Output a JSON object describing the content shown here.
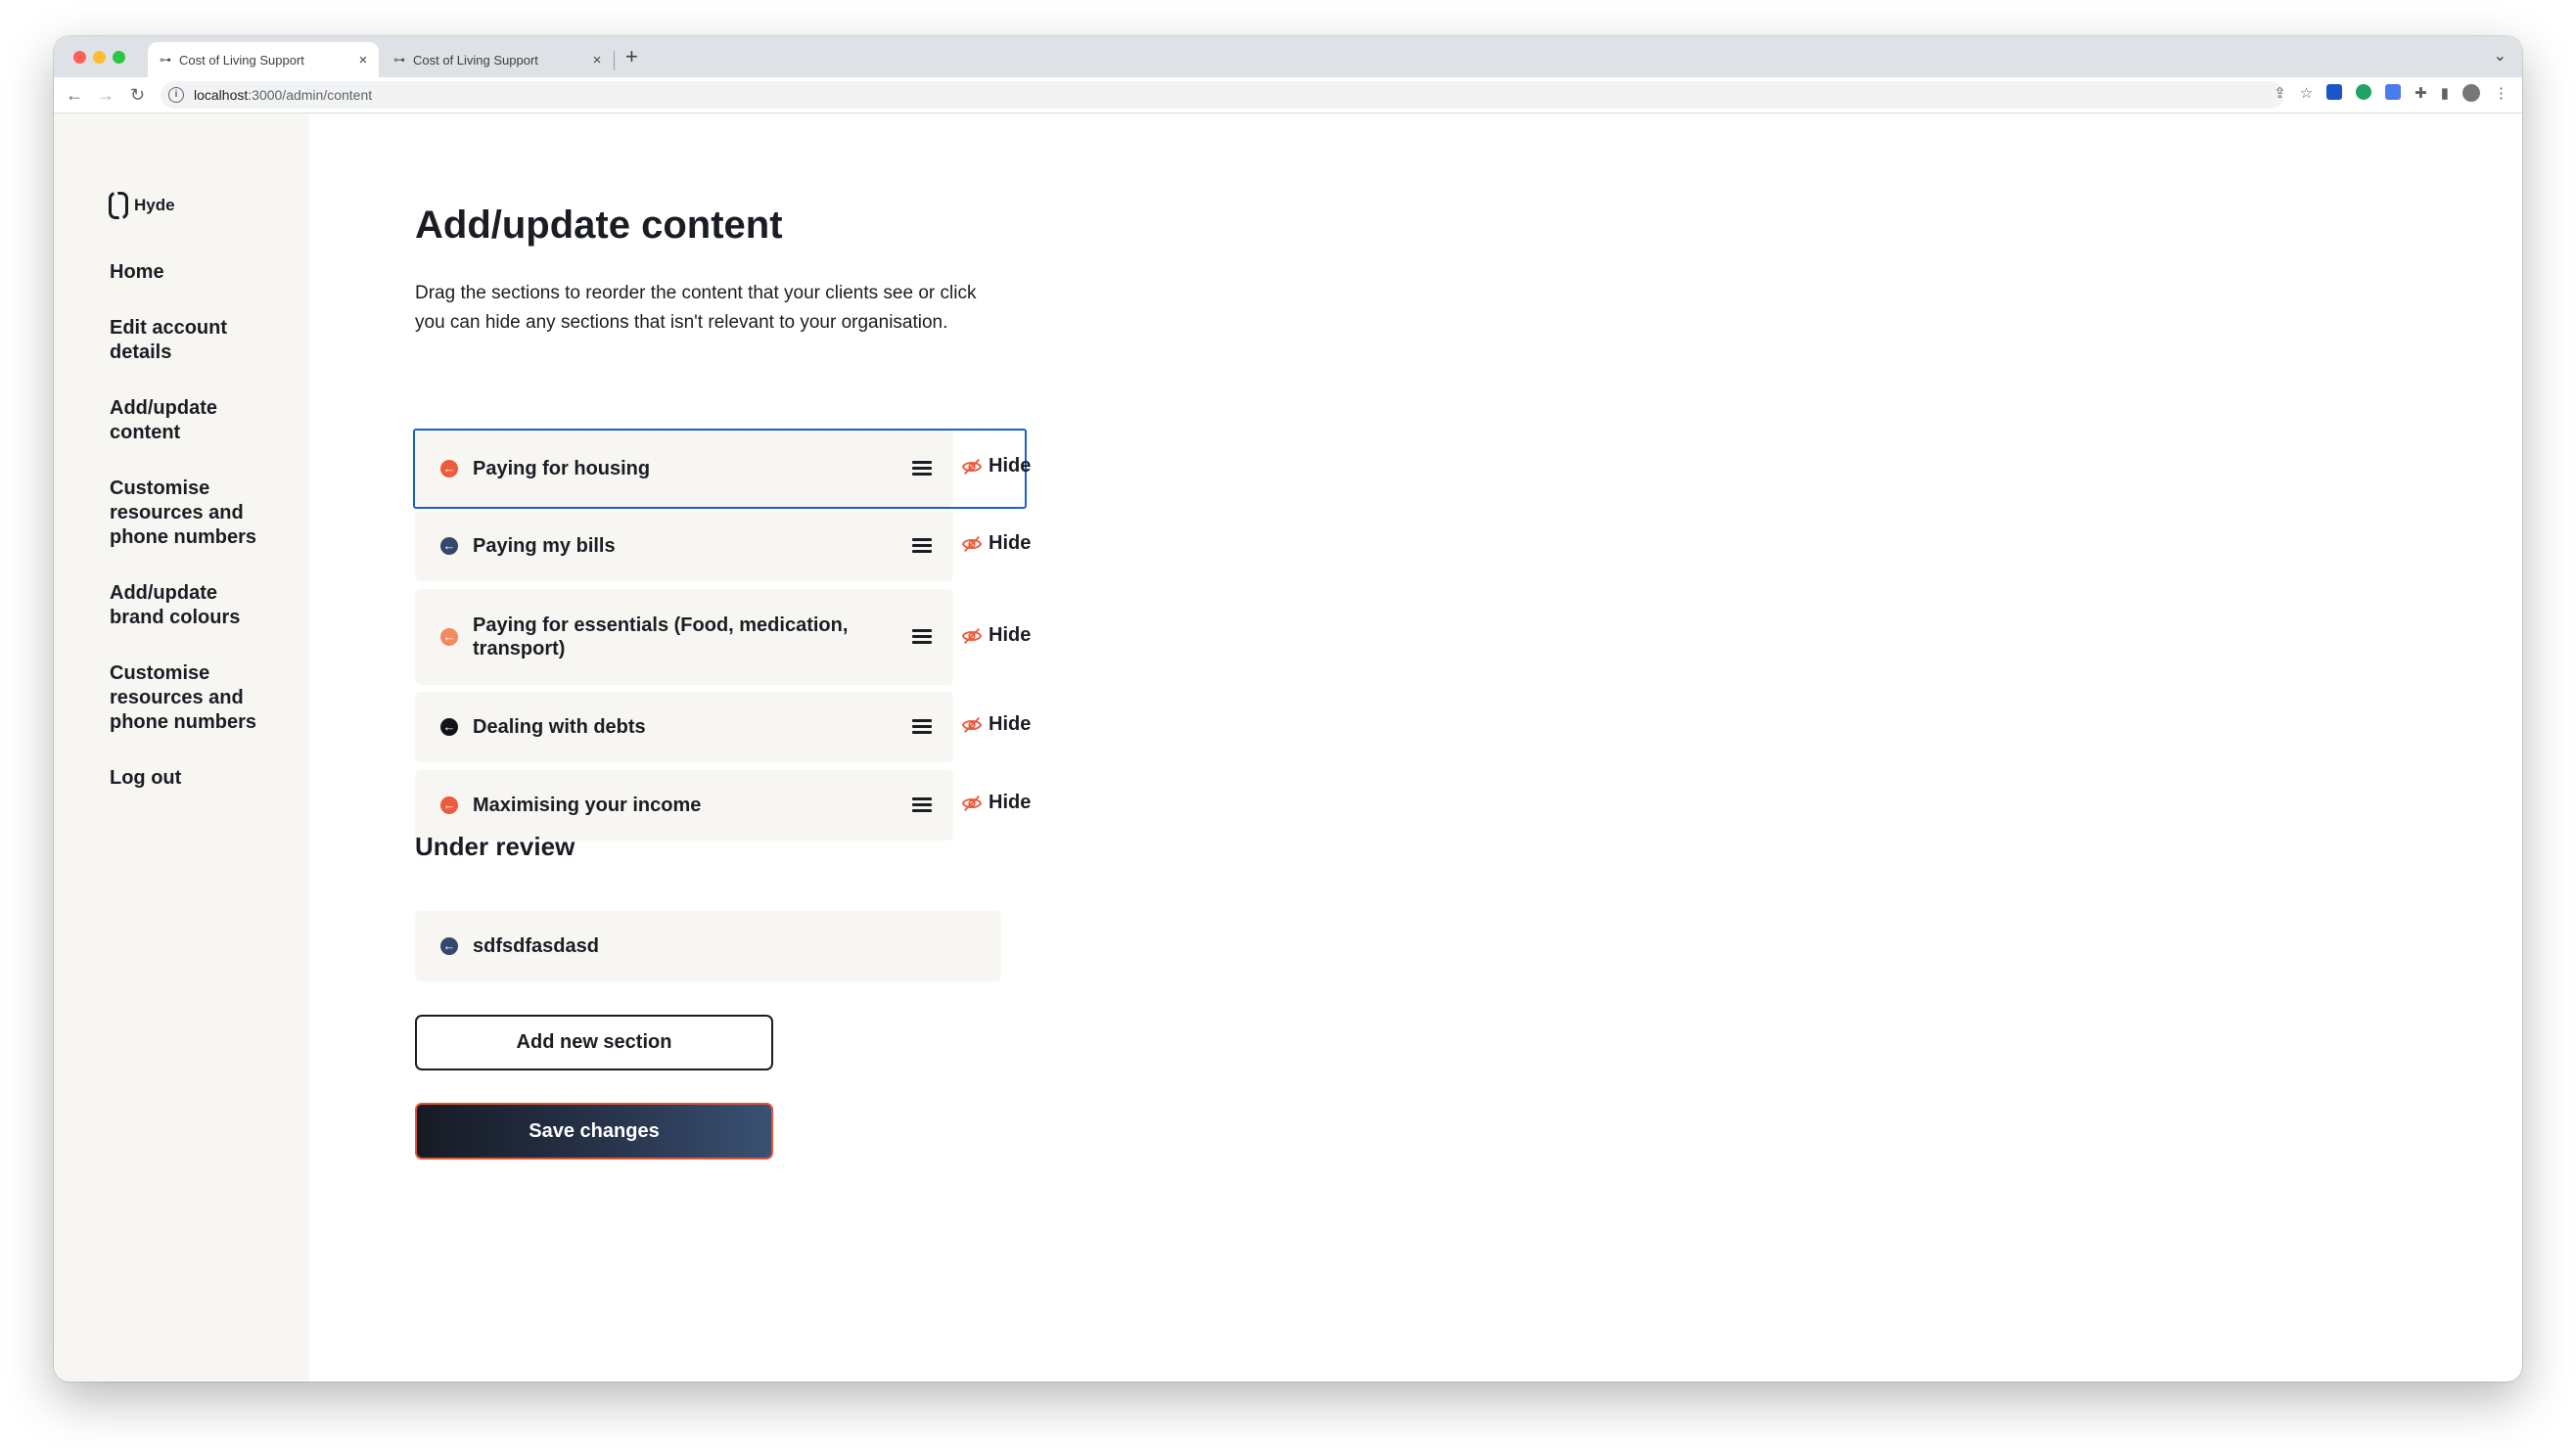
{
  "browser": {
    "tabs": [
      {
        "title": "Cost of Living Support",
        "active": true
      },
      {
        "title": "Cost of Living Support",
        "active": false
      }
    ],
    "url_host": "localhost",
    "url_path": ":3000/admin/content"
  },
  "sidebar": {
    "logo_text": "Hyde",
    "items": [
      {
        "label": "Home"
      },
      {
        "label": "Edit account details"
      },
      {
        "label": "Add/update content"
      },
      {
        "label": "Customise resources and phone numbers"
      },
      {
        "label": "Add/update brand colours"
      },
      {
        "label": "Customise resources and phone numbers"
      },
      {
        "label": "Log out"
      }
    ]
  },
  "main": {
    "title": "Add/update content",
    "intro": "Drag the sections to reorder the content that your clients see or click you can hide any sections that isn't relevant to your organisation.",
    "sections": [
      {
        "label": "Paying for housing",
        "hide_label": "Hide",
        "color": "#ee5a3c"
      },
      {
        "label": "Paying my bills",
        "hide_label": "Hide",
        "color": "#34486b"
      },
      {
        "label": "Paying for essentials (Food, medication, transport)",
        "hide_label": "Hide",
        "color": "#f3895c"
      },
      {
        "label": "Dealing with debts",
        "hide_label": "Hide",
        "color": "#111318"
      },
      {
        "label": "Maximising your income",
        "hide_label": "Hide",
        "color": "#ee5a3c"
      }
    ],
    "under_review_heading": "Under review",
    "review_items": [
      {
        "label": "sdfsdfasdasd",
        "color": "#34486b"
      }
    ],
    "add_button": "Add new section",
    "save_button": "Save changes"
  },
  "colors": {
    "sidebar_bg": "#f8f6f2",
    "card_bg": "#f8f6f2",
    "focus_outline": "#1a61c9",
    "hide_icon": "#ee5a3c",
    "save_border": "#e0553a"
  }
}
